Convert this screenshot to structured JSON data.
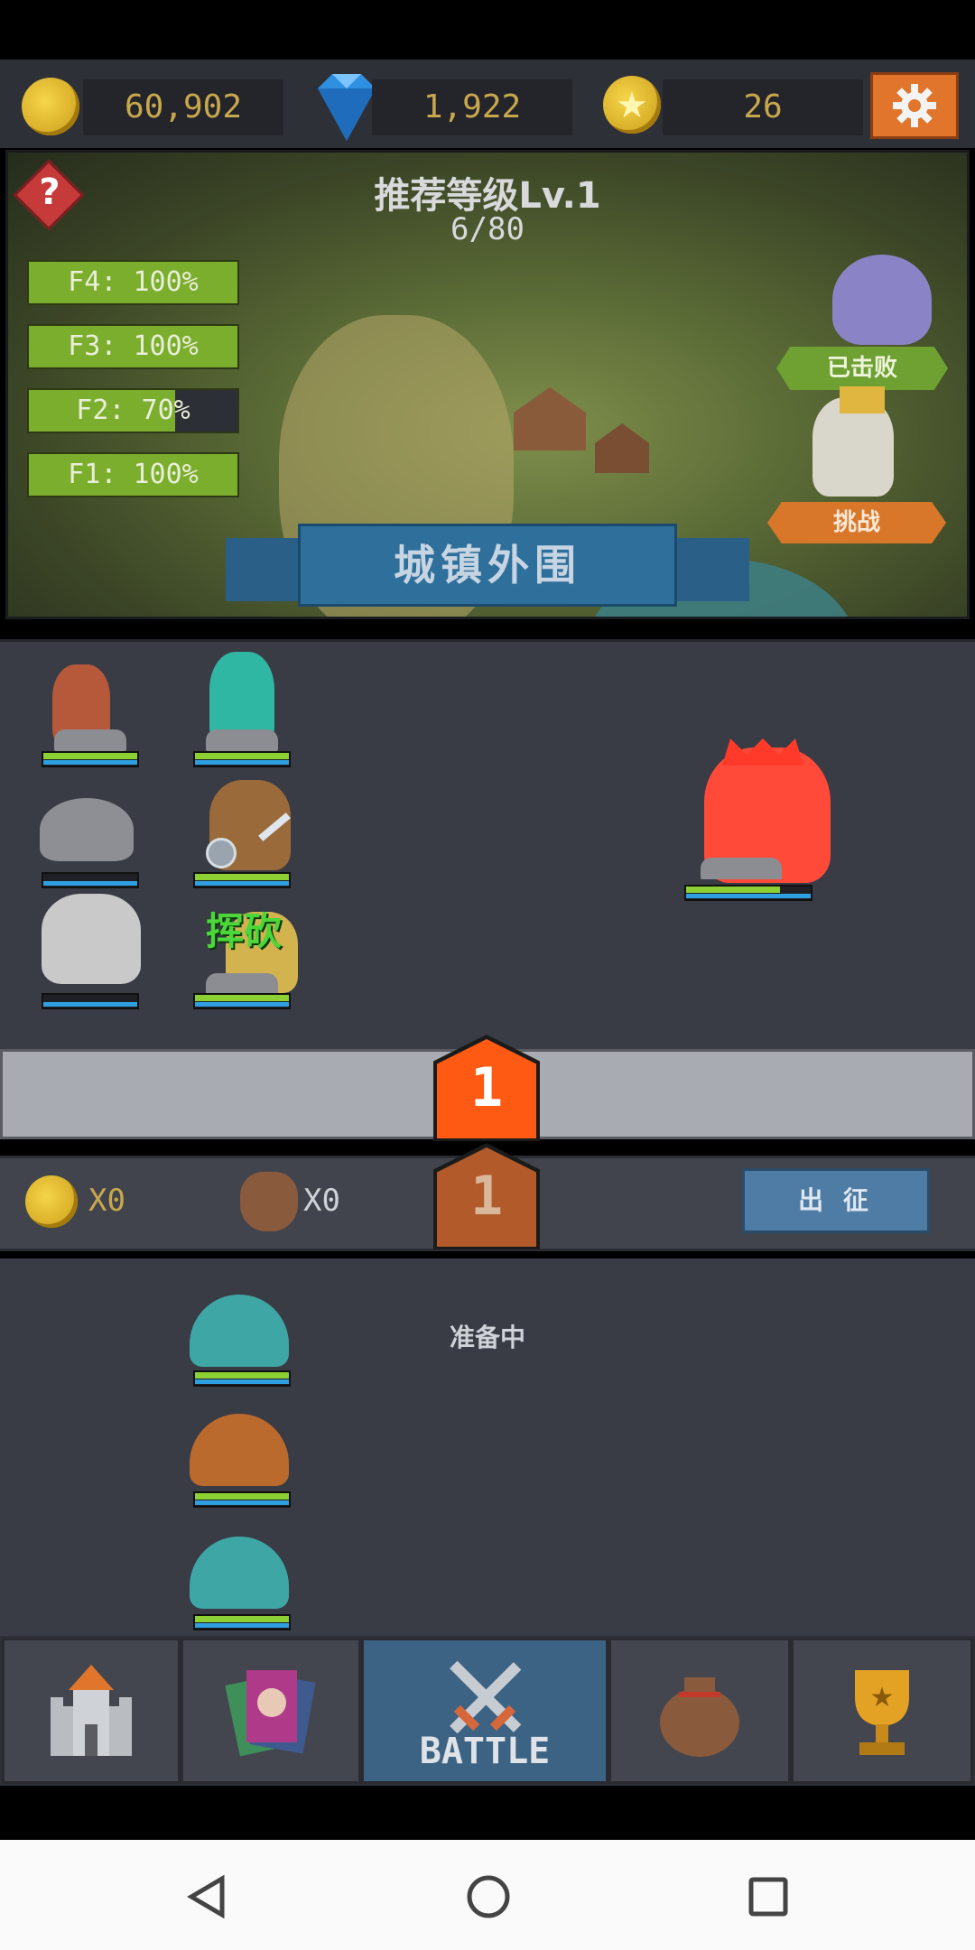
{
  "currencies": {
    "gold": "60,902",
    "gems": "1,922",
    "stars": "26"
  },
  "stage": {
    "recommend_level": "推荐等级Lv.1",
    "progress": "6/80",
    "name": "城镇外围",
    "floors": [
      {
        "label": "F4: 100%",
        "fill": 1.0
      },
      {
        "label": "F3: 100%",
        "fill": 1.0
      },
      {
        "label": "F2: 70%",
        "fill": 0.7
      },
      {
        "label": "F1: 100%",
        "fill": 1.0
      }
    ],
    "defeated_label": "已击败",
    "challenge_label": "挑战"
  },
  "battle": {
    "skill_text": "挥砍",
    "enemy_hp": 0.75,
    "wave_number": "1",
    "next_wave_number": "1"
  },
  "loot": {
    "gold_count": "X0",
    "bag_count": "X0",
    "sortie_label": "出 征"
  },
  "reserve": {
    "status": "准备中"
  },
  "nav": {
    "battle_label": "BATTLE"
  },
  "colors": {
    "accent_orange": "#e0752b",
    "hp_green": "#8cd033",
    "mp_blue": "#2e9fe0",
    "enemy_red": "#ff4a3a"
  }
}
